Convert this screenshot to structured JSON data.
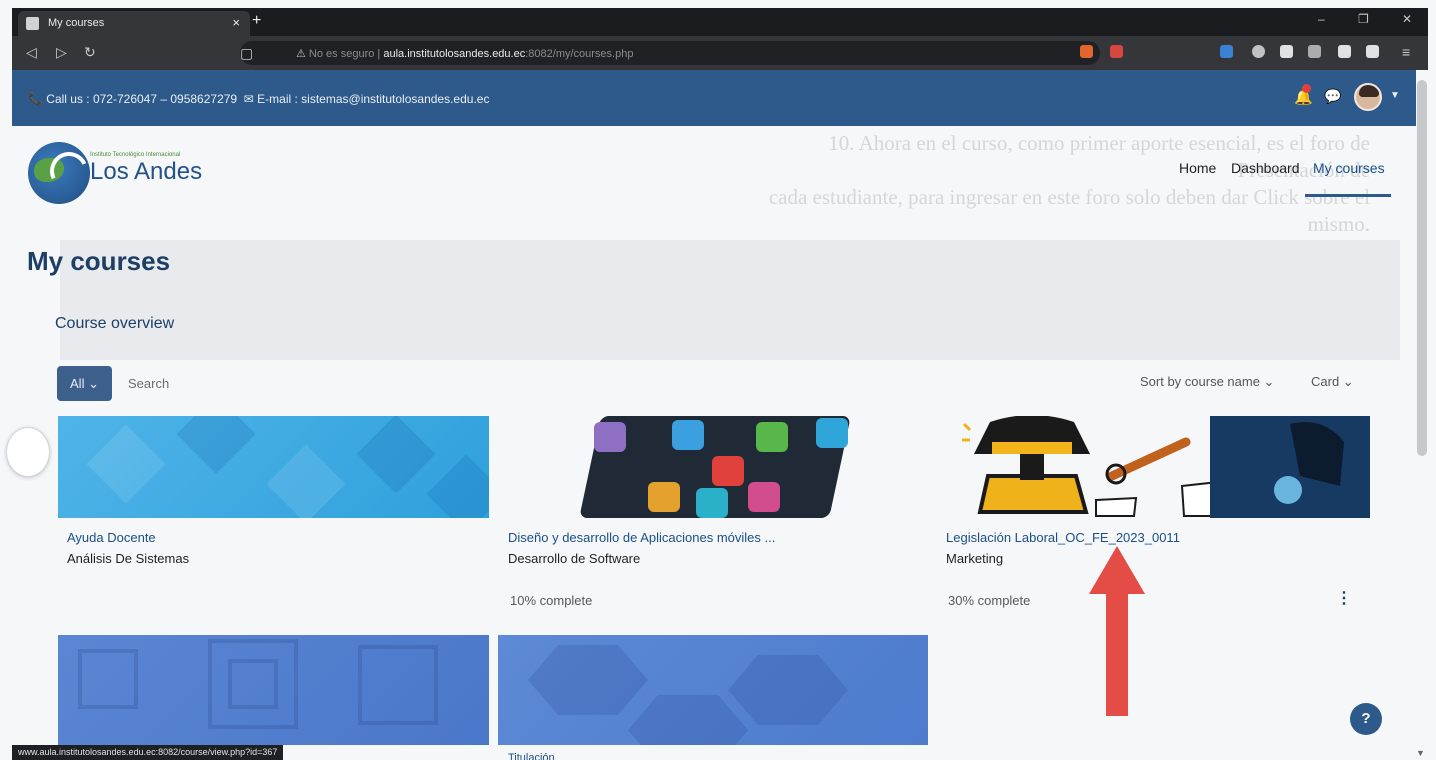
{
  "browser": {
    "tab_title": "My courses",
    "tab_close": "×",
    "new_tab": "+",
    "url_secure_label": "No es seguro",
    "url_host": "aula.institutolosandes.edu.ec",
    "url_rest": ":8082/my/courses.php",
    "win_min": "–",
    "win_max": "❐",
    "win_close": "✕"
  },
  "topbar": {
    "phone_label": "📞 Call us : 072-726047 – 0958627279",
    "email_label": "✉ E-mail : sistemas@institutolosandes.edu.ec"
  },
  "watermark": {
    "line1": "10.  Ahora en el curso, como primer aporte esencial, es el foro de Presentación de",
    "line2": "cada estudiante, para ingresar en este foro solo deben dar Click sobre el",
    "line3": "mismo."
  },
  "logo": {
    "tagline": "Instituto Tecnológico Internacional",
    "name": "Los Andes"
  },
  "nav": {
    "home": "Home",
    "dashboard": "Dashboard",
    "my_courses": "My courses"
  },
  "page": {
    "heading": "My courses",
    "block_title": "Course overview"
  },
  "controls": {
    "filter_label": "All ⌄",
    "search_placeholder": "Search",
    "sort_label": "Sort by course name  ⌄",
    "view_label": "Card  ⌄"
  },
  "courses": [
    {
      "name": "Ayuda Docente",
      "category": "Análisis De Sistemas",
      "progress": ""
    },
    {
      "name": "Diseño y desarrollo de Aplicaciones móviles ...",
      "category": "Desarrollo de Software",
      "progress": "10% complete"
    },
    {
      "name": "Legislación Laboral_OC_FE_2023_0011",
      "category": "Marketing",
      "progress": "30% complete"
    },
    {
      "name": "",
      "category": "",
      "progress": ""
    },
    {
      "name": "Titulación",
      "category": "",
      "progress": ""
    }
  ],
  "status_url": "www.aula.institutolosandes.edu.ec:8082/course/view.php?id=367",
  "help_label": "?",
  "kebab_label": "⋮",
  "colors": {
    "brand_blue": "#2d5a8a",
    "link_blue": "#1a4f87",
    "arrow_red": "#e44c46"
  },
  "icons": [
    "back-icon",
    "forward-icon",
    "reload-icon",
    "bookmark-icon",
    "bell-icon",
    "chat-icon",
    "user-avatar-icon",
    "kebab-icon",
    "help-icon"
  ]
}
